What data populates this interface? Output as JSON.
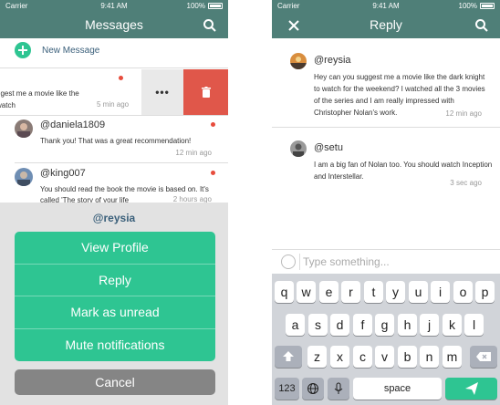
{
  "status_bar": {
    "carrier": "Carrier",
    "time": "9:41 AM",
    "battery": "100%"
  },
  "left": {
    "title": "Messages",
    "new_message": "New Message",
    "swiped": {
      "text": "ggest me a movie like the\nwatch",
      "time": "5 min ago"
    },
    "messages": [
      {
        "name": "@daniela1809",
        "text": "Thank you! That was a great recommendation!",
        "time": "12 min ago"
      },
      {
        "name": "@king007",
        "text": "You should read the book the movie is based on. It's called 'The story of your life",
        "time": "2 hours ago"
      }
    ],
    "action_sheet": {
      "title": "@reysia",
      "options": [
        "View Profile",
        "Reply",
        "Mark as unread",
        "Mute notifications"
      ],
      "cancel": "Cancel"
    }
  },
  "right": {
    "title": "Reply",
    "messages": [
      {
        "name": "@reysia",
        "text": "Hey can you suggest me a movie like the dark knight to watch for the weekend? I watched all the 3 movies of the series and I am really impressed with Christopher Nolan's work.",
        "time": "12 min ago"
      },
      {
        "name": "@setu",
        "text": "I am a big fan of Nolan too. You should watch Inception and Interstellar.",
        "time": "3 sec ago"
      }
    ],
    "input_placeholder": "Type something...",
    "keyboard": {
      "row1": [
        "q",
        "w",
        "e",
        "r",
        "t",
        "y",
        "u",
        "i",
        "o",
        "p"
      ],
      "row2": [
        "a",
        "s",
        "d",
        "f",
        "g",
        "h",
        "j",
        "k",
        "l"
      ],
      "row3": [
        "z",
        "x",
        "c",
        "v",
        "b",
        "n",
        "m"
      ],
      "numbers": "123",
      "space": "space"
    }
  },
  "colors": {
    "header": "#4f7f78",
    "accent": "#2ec592",
    "delete": "#e0574a",
    "unread": "#e74c3c"
  }
}
